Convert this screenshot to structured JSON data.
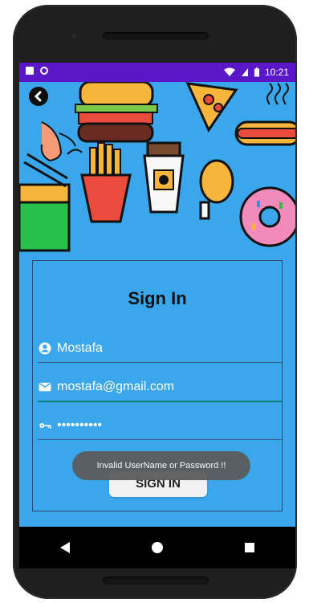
{
  "status": {
    "time": "10:21"
  },
  "screen": {
    "title": "Sign In",
    "username": {
      "value": "Mostafa"
    },
    "email": {
      "value": "mostafa@gmail.com"
    },
    "password": {
      "value": "••••••••••"
    },
    "sign_in_button": "SIGN IN",
    "toast": "Invalid UserName or Password !!"
  }
}
